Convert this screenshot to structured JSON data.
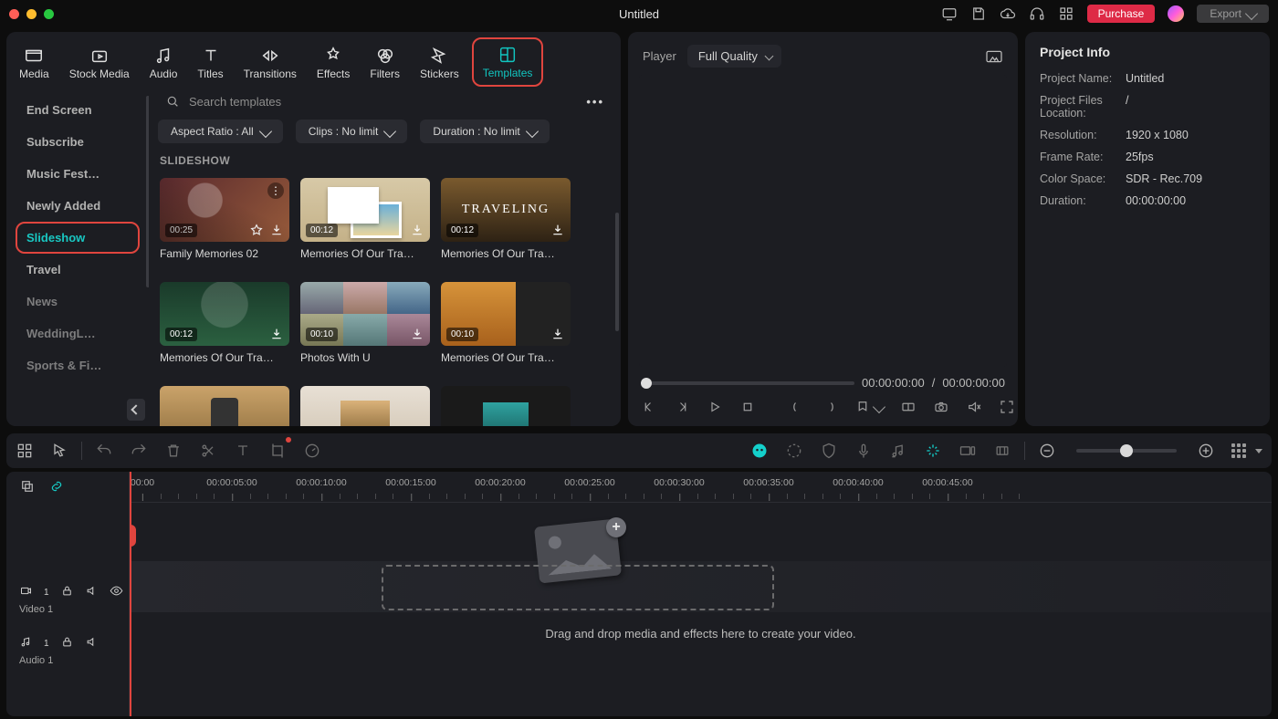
{
  "title": "Untitled",
  "top_right": {
    "purchase": "Purchase",
    "export": "Export"
  },
  "lib_tabs": [
    {
      "id": "media",
      "label": "Media"
    },
    {
      "id": "stock",
      "label": "Stock Media"
    },
    {
      "id": "audio",
      "label": "Audio"
    },
    {
      "id": "titles",
      "label": "Titles"
    },
    {
      "id": "transitions",
      "label": "Transitions"
    },
    {
      "id": "effects",
      "label": "Effects"
    },
    {
      "id": "filters",
      "label": "Filters"
    },
    {
      "id": "stickers",
      "label": "Stickers"
    },
    {
      "id": "templates",
      "label": "Templates"
    }
  ],
  "categories": [
    {
      "label": "End Screen"
    },
    {
      "label": "Subscribe"
    },
    {
      "label": "Music Fest…"
    },
    {
      "label": "Newly Added"
    },
    {
      "label": "Slideshow",
      "selected": true
    },
    {
      "label": "Travel"
    },
    {
      "label": "News",
      "dim": true
    },
    {
      "label": "WeddingL…",
      "dim": true
    },
    {
      "label": "Sports & Fi…",
      "dim": true
    }
  ],
  "search": {
    "placeholder": "Search templates"
  },
  "filters": {
    "aspect": "Aspect Ratio : All",
    "clips": "Clips : No limit",
    "duration": "Duration : No limit"
  },
  "grid_title": "SLIDESHOW",
  "templates": [
    {
      "name": "Family Memories 02",
      "dur": "00:25",
      "th": "th1",
      "menu": true,
      "fav": true
    },
    {
      "name": "Memories Of Our Tra…",
      "dur": "00:12",
      "th": "th2"
    },
    {
      "name": "Memories Of Our Tra…",
      "dur": "00:12",
      "th": "th3"
    },
    {
      "name": "Memories Of Our Tra…",
      "dur": "00:12",
      "th": "th4"
    },
    {
      "name": "Photos With U",
      "dur": "00:10",
      "th": "th5"
    },
    {
      "name": "Memories Of Our Tra…",
      "dur": "00:10",
      "th": "th6"
    },
    {
      "name": "",
      "dur": "",
      "th": "th7"
    },
    {
      "name": "",
      "dur": "",
      "th": "th8"
    },
    {
      "name": "",
      "dur": "",
      "th": "th9"
    }
  ],
  "player": {
    "label": "Player",
    "quality": "Full Quality",
    "cur": "00:00:00:00",
    "sep": "/",
    "total": "00:00:00:00"
  },
  "info": {
    "title": "Project Info",
    "rows": [
      {
        "k": "Project Name:",
        "v": "Untitled"
      },
      {
        "k": "Project Files Location:",
        "v": "/"
      },
      {
        "k": "Resolution:",
        "v": "1920 x 1080"
      },
      {
        "k": "Frame Rate:",
        "v": "25fps"
      },
      {
        "k": "Color Space:",
        "v": "SDR - Rec.709"
      },
      {
        "k": "Duration:",
        "v": "00:00:00:00"
      }
    ]
  },
  "timeline": {
    "ruler": [
      "00:00",
      "00:00:05:00",
      "00:00:10:00",
      "00:00:15:00",
      "00:00:20:00",
      "00:00:25:00",
      "00:00:30:00",
      "00:00:35:00",
      "00:00:40:00",
      "00:00:45:00"
    ],
    "tracks": [
      {
        "type": "video",
        "num": "1",
        "label": "Video 1",
        "eye": true
      },
      {
        "type": "audio",
        "num": "1",
        "label": "Audio 1"
      }
    ],
    "drop_text": "Drag and drop media and effects here to create your video."
  }
}
